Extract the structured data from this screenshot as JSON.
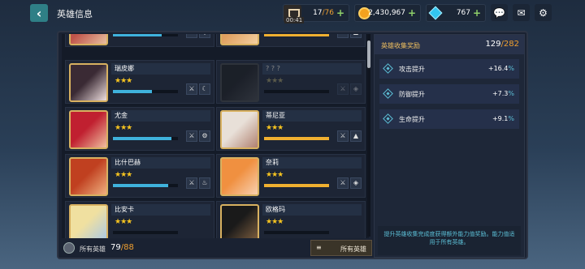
{
  "header": {
    "title": "英雄信息",
    "stamina": {
      "current": "17",
      "max": "/76",
      "timer": "00:41"
    },
    "gold": "2,430,967",
    "gems": "767",
    "plus": "+"
  },
  "heroes": [
    {
      "name": "",
      "stars": "★★★",
      "locked": false,
      "bar": 0.75,
      "bar_color": "#3fb2dc",
      "icons": [
        "⚔",
        "◈"
      ],
      "col": 0,
      "row": -1
    },
    {
      "name": "",
      "stars": "★★★",
      "locked": false,
      "bar": 1.0,
      "bar_color": "#f0b030",
      "icons": [
        "⚔",
        "▲"
      ],
      "col": 1,
      "row": -1
    },
    {
      "name": "瑞皮娜",
      "stars": "★★★",
      "locked": false,
      "bar": 0.6,
      "bar_color": "#3fb2dc",
      "icons": [
        "⚔",
        "☾"
      ],
      "col": 0,
      "row": 0
    },
    {
      "name": "? ? ?",
      "stars": "★★★",
      "locked": true,
      "bar": 0,
      "bar_color": "#333",
      "icons": [
        "⚔",
        "◈"
      ],
      "col": 1,
      "row": 0
    },
    {
      "name": "尤金",
      "stars": "★★★",
      "locked": false,
      "bar": 0.9,
      "bar_color": "#3fb2dc",
      "icons": [
        "⚔",
        "⚙"
      ],
      "col": 0,
      "row": 1
    },
    {
      "name": "蒂尼亚",
      "stars": "★★★",
      "locked": false,
      "bar": 1.0,
      "bar_color": "#f0b030",
      "icons": [
        "⚔",
        "▲"
      ],
      "col": 1,
      "row": 1
    },
    {
      "name": "比什巴赫",
      "stars": "★★★",
      "locked": false,
      "bar": 0.85,
      "bar_color": "#3fb2dc",
      "icons": [
        "⚔",
        "♨"
      ],
      "col": 0,
      "row": 2
    },
    {
      "name": "奈莉",
      "stars": "★★★",
      "locked": false,
      "bar": 1.0,
      "bar_color": "#f0b030",
      "icons": [
        "⚔",
        "◈"
      ],
      "col": 1,
      "row": 2
    },
    {
      "name": "比安卡",
      "stars": "★★★",
      "locked": false,
      "bar": 0,
      "bar_color": "#3fb2dc",
      "icons": [],
      "col": 0,
      "row": 3
    },
    {
      "name": "欧格玛",
      "stars": "★★★",
      "locked": false,
      "bar": 0,
      "bar_color": "#f0b030",
      "icons": [],
      "col": 1,
      "row": 3
    }
  ],
  "footer": {
    "label": "所有英雄",
    "count": "79",
    "max": "/88",
    "filter_icon": "≡",
    "filter_label": "所有英雄"
  },
  "collection": {
    "title": "英雄收集奖励",
    "count": "129",
    "max": "/282",
    "stats": [
      {
        "name": "攻击提升",
        "value": "+16.4",
        "pct": "%"
      },
      {
        "name": "防御提升",
        "value": "+7.3",
        "pct": "%"
      },
      {
        "name": "生命提升",
        "value": "+9.1",
        "pct": "%"
      }
    ],
    "note": "提升英雄收集完成度获得额外能力值奖励。能力值适用于所有英雄。"
  },
  "colors": {
    "accent": "#5cbfd6",
    "gold": "#f0a030"
  }
}
